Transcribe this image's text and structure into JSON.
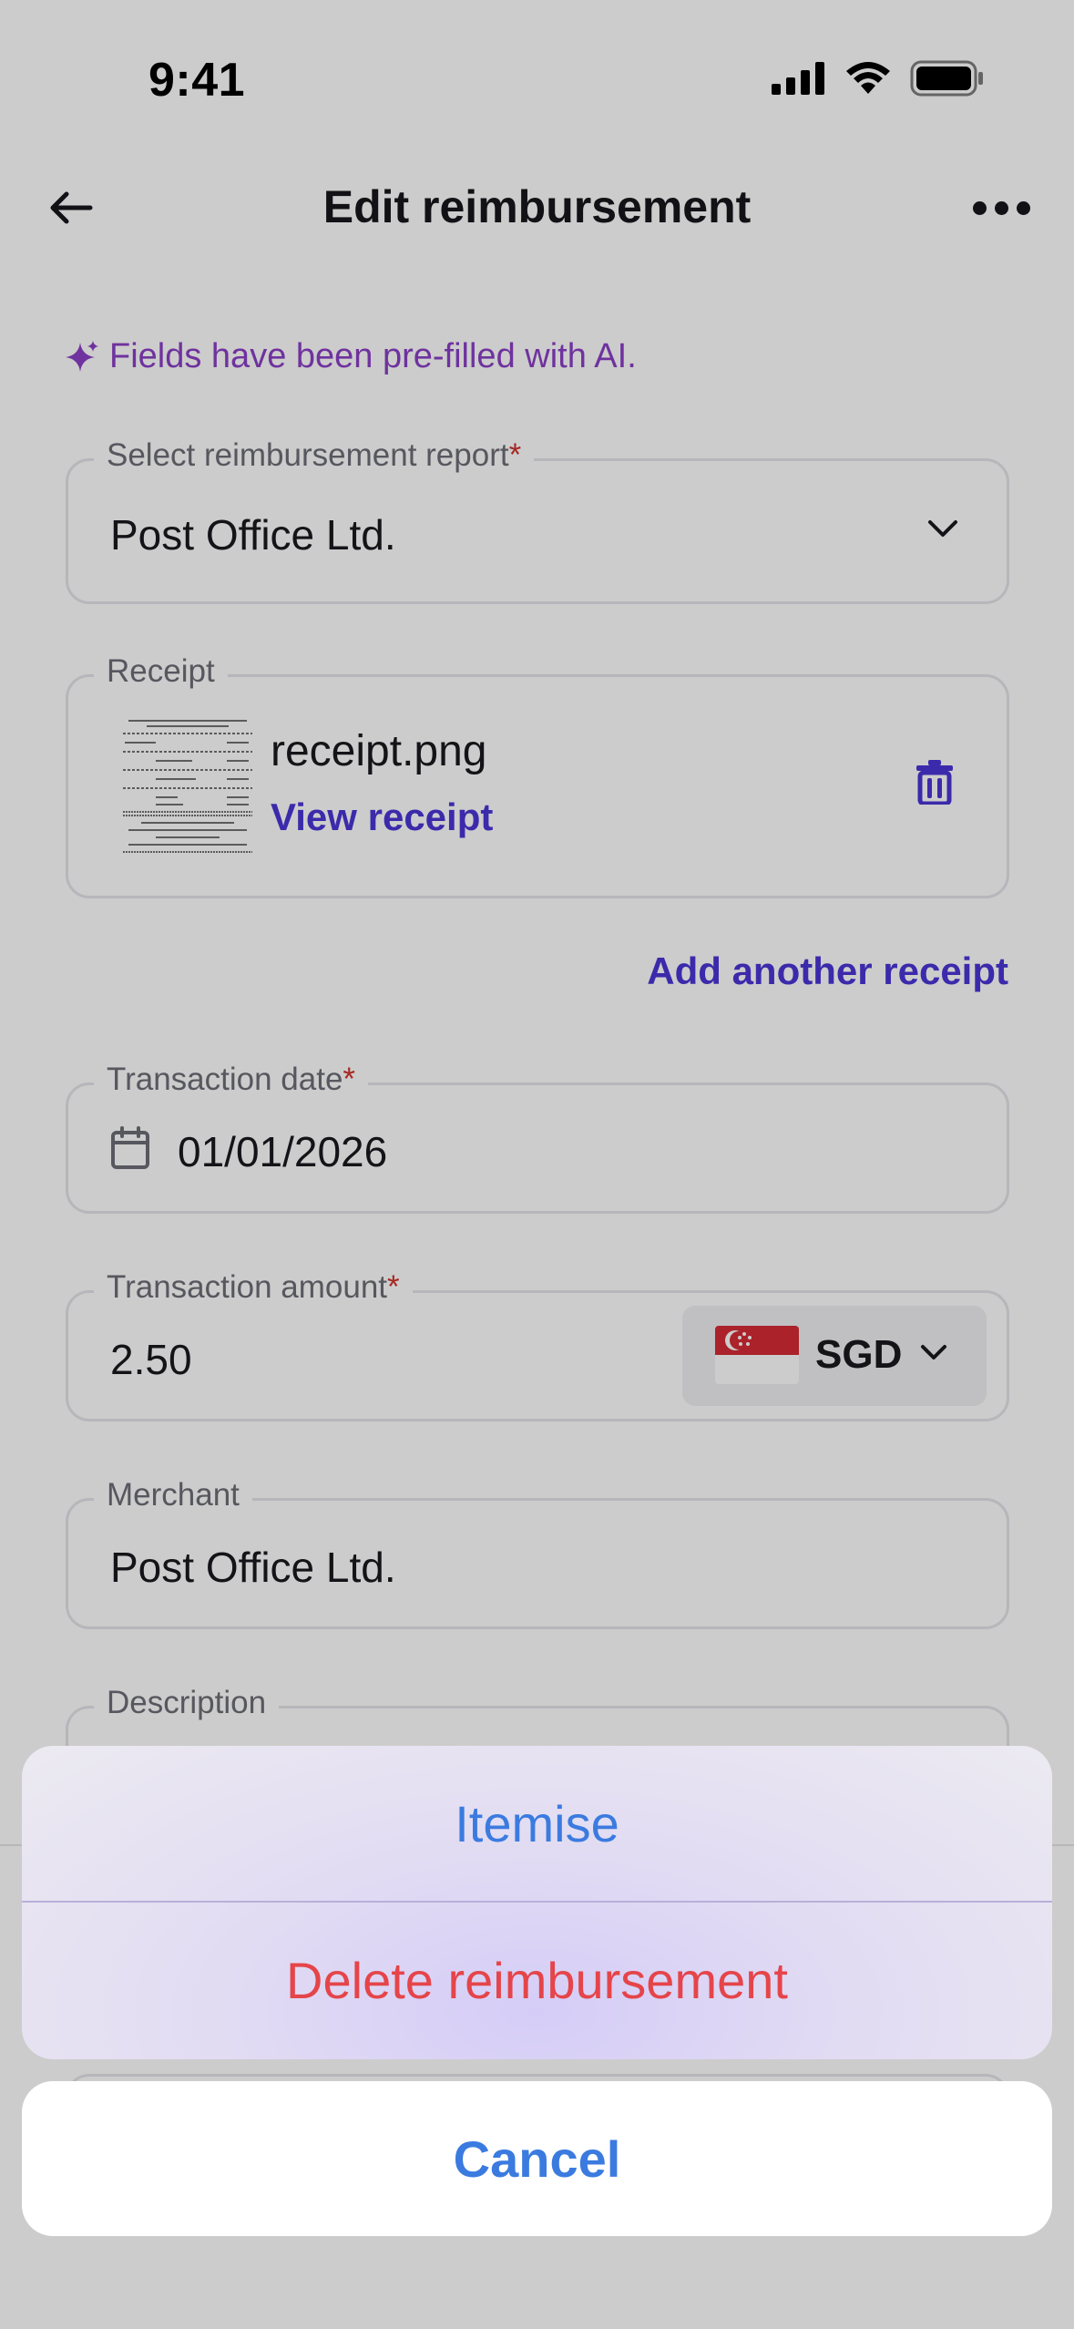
{
  "status_bar": {
    "time": "9:41"
  },
  "header": {
    "title": "Edit reimbursement"
  },
  "ai_note": "Fields have been pre-filled with AI.",
  "form": {
    "report": {
      "label": "Select reimbursement report",
      "required_mark": "*",
      "value": "Post Office Ltd."
    },
    "receipt": {
      "label": "Receipt",
      "file_name": "receipt.png",
      "view_link": "View receipt"
    },
    "add_receipt": "Add another receipt",
    "transaction_date": {
      "label": "Transaction date",
      "required_mark": "*",
      "value": "01/01/2026"
    },
    "transaction_amount": {
      "label": "Transaction amount",
      "required_mark": "*",
      "value": "2.50",
      "currency": "SGD"
    },
    "merchant": {
      "label": "Merchant",
      "value": "Post Office Ltd."
    },
    "description": {
      "label": "Description"
    }
  },
  "action_sheet": {
    "itemise": "Itemise",
    "delete": "Delete reimbursement",
    "cancel": "Cancel"
  },
  "colors": {
    "accent": "#4a35d6",
    "ai_purple": "#8b3fc6",
    "required_red": "#d0342c",
    "action_blue": "#3b7be0",
    "destructive_red": "#e5454a"
  },
  "icons": [
    "back-arrow-icon",
    "more-icon",
    "sparkle-icon",
    "chevron-down-icon",
    "trash-icon",
    "calendar-icon",
    "singapore-flag-icon",
    "signal-icon",
    "wifi-icon",
    "battery-icon"
  ]
}
